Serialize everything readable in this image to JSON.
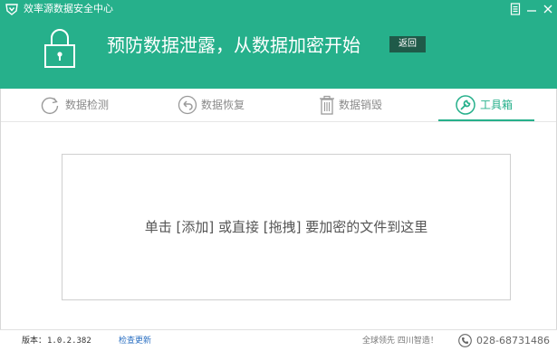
{
  "app": {
    "title": "效率源数据安全中心",
    "logo_icon": "shield-logo-icon"
  },
  "window_controls": {
    "menu_icon": "menu-icon",
    "minimize_icon": "minimize-icon",
    "close_icon": "close-icon"
  },
  "banner": {
    "icon": "lock-icon",
    "text": "预防数据泄露，从数据加密开始",
    "back_label": "返回"
  },
  "tabs": [
    {
      "label": "数据检测",
      "icon": "refresh-circle-icon",
      "active": false
    },
    {
      "label": "数据恢复",
      "icon": "undo-circle-icon",
      "active": false
    },
    {
      "label": "数据销毁",
      "icon": "trash-icon",
      "active": false
    },
    {
      "label": "工具箱",
      "icon": "wrench-icon",
      "active": true
    }
  ],
  "drop_zone": {
    "text": "单击 [添加] 或直接 [拖拽] 要加密的文件到这里"
  },
  "status": {
    "version_label": "版本：",
    "version_value": "1.0.2.382",
    "update_link": "检查更新",
    "slogan": "全球领先 四川智造！",
    "phone_icon": "phone-icon",
    "phone": "028-68731486"
  },
  "colors": {
    "brand": "#26b08b",
    "back_button_bg": "#1f5a49",
    "link": "#2a6fc2",
    "inactive_tab": "#8a8a8a"
  }
}
